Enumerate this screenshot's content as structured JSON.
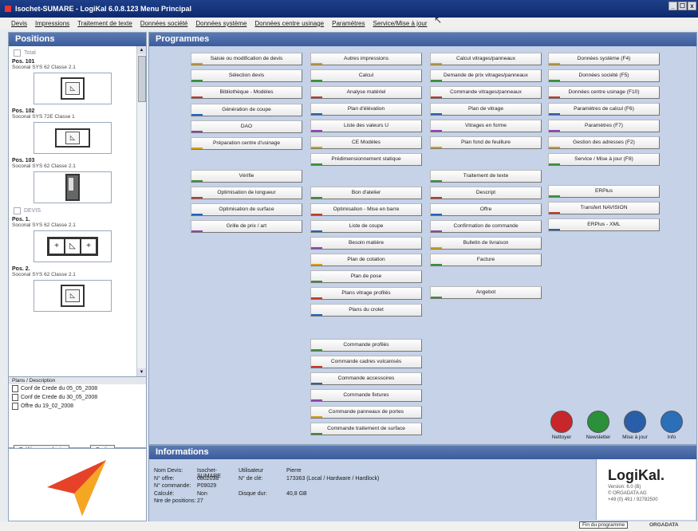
{
  "window": {
    "title": "Isochet-SUMARE - LogiKal 6.0.8.123 Menu Principal",
    "min": "_",
    "max": "☐",
    "close": "x"
  },
  "menu": [
    "Devis",
    "Impressions",
    "Traitement de texte",
    "Données société",
    "Données système",
    "Données centre usinage",
    "Paramètres",
    "Service/Mise à jour"
  ],
  "positions": {
    "header": "Positions",
    "group_total": "Total",
    "items": [
      {
        "num": "Pos. 101",
        "desc": "Soconal SYS 62 Classe 2.1"
      },
      {
        "num": "Pos. 102",
        "desc": "Soconal SYS 72E Classe 1"
      },
      {
        "num": "Pos. 103",
        "desc": "Soconal SYS 62 Classe 2.1"
      }
    ],
    "group_devis": "DEVIS",
    "items2": [
      {
        "num": "Pos. 1.",
        "desc": "Soconal SYS 62 Classe 2.1"
      },
      {
        "num": "Pos. 2.",
        "desc": "Soconal SYS 62 Classe 2.1"
      }
    ]
  },
  "plans": {
    "header": "Plans / Description",
    "rows": [
      "Conf de Crede du 05_05_2008",
      "Conf de Crede du 30_05_2008",
      "Offre du 19_02_2008"
    ]
  },
  "left_buttons": {
    "prefs": "Préférences devis",
    "quit": "Sortir"
  },
  "programmes": {
    "header": "Programmes",
    "col1": [
      "Saisie ou modification de devis",
      "Sélection devis",
      "Bibliothèque - Modèles",
      "Génération de coupe",
      "DAO",
      "Préparation centre d'usinage"
    ],
    "col1b": [
      "Vérifie",
      "Optimisation de longueur",
      "Optimisation de surface",
      "Grille de prix / art"
    ],
    "col2": [
      "Autres impressions",
      "Calcul",
      "Analyse matériel",
      "Plan d'élévation",
      "Liste des valeurs U",
      "CE Modèles",
      "Prédimensionnement statique"
    ],
    "col2b": [
      "Bon d'atelier",
      "Optimisation - Mise en barre",
      "Liste de coupe",
      "Besoin matière",
      "Plan de cotation",
      "Plan de pose",
      "Plans vitrage profilés",
      "Plans du crolet"
    ],
    "col2c": [
      "Commande profilés",
      "Commande cadres vulcanisés",
      "Commande accessoires",
      "Commande fixtures",
      "Commande panneaux de portes",
      "Commande traitement de surface"
    ],
    "col3": [
      "Calcul vitrages/panneaux",
      "Demande de prix vitrages/panneaux",
      "Commande vitrages/panneaux",
      "Plan de vitrage",
      "Vitrages en forme",
      "Plan fond de feuillure"
    ],
    "col3b": [
      "Traitement de texte",
      "Descript",
      "Offre",
      "Confirmation de commande",
      "Bulletin de livraison",
      "Facture"
    ],
    "col3c": [
      "Angebot"
    ],
    "col4": [
      "Données système (F4)",
      "Données société (F5)",
      "Données centre usinage (F10)",
      "Paramètres de calcul (F6)",
      "Paramètres (F7)",
      "Gestion des adresses (F2)",
      "Service / Mise à jour (F8)"
    ],
    "col4b": [
      "ERPlus",
      "Transfert NAVISION",
      "ERPlus - XML"
    ],
    "icons": [
      {
        "label": "Nettoyer",
        "color": "#c8262a"
      },
      {
        "label": "Newsletter",
        "color": "#2c8f3a"
      },
      {
        "label": "Mise à jour",
        "color": "#2a5ea8"
      },
      {
        "label": "Info",
        "color": "#2a6fb8"
      }
    ]
  },
  "informations": {
    "header": "Informations",
    "rows": [
      {
        "k1": "Nom Devis:",
        "v1": "Isochet-SUMARE",
        "k2": "Utilisateur",
        "v2": "Pierre"
      },
      {
        "k1": "N° offre:",
        "v1": "0802038",
        "k2": "N° de clé:",
        "v2": "173363 (Local / Hardware / Hardlock)"
      },
      {
        "k1": "N° commande:",
        "v1": "P09029",
        "k2": "",
        "v2": ""
      },
      {
        "k1": "Calculé:",
        "v1": "Non",
        "k2": "Disque dur:",
        "v2": "40,8 GB"
      },
      {
        "k1": "Nre de positions:",
        "v1": "27",
        "k2": "",
        "v2": ""
      }
    ],
    "brand": "LogiKal.",
    "version": "Version: 6.0 (B)",
    "company": "© ORGADATA AG",
    "phone": "+49 (0) 491 / 92782500"
  },
  "status": {
    "progress": "Fin du programme",
    "orgadata": "ORGADATA"
  }
}
